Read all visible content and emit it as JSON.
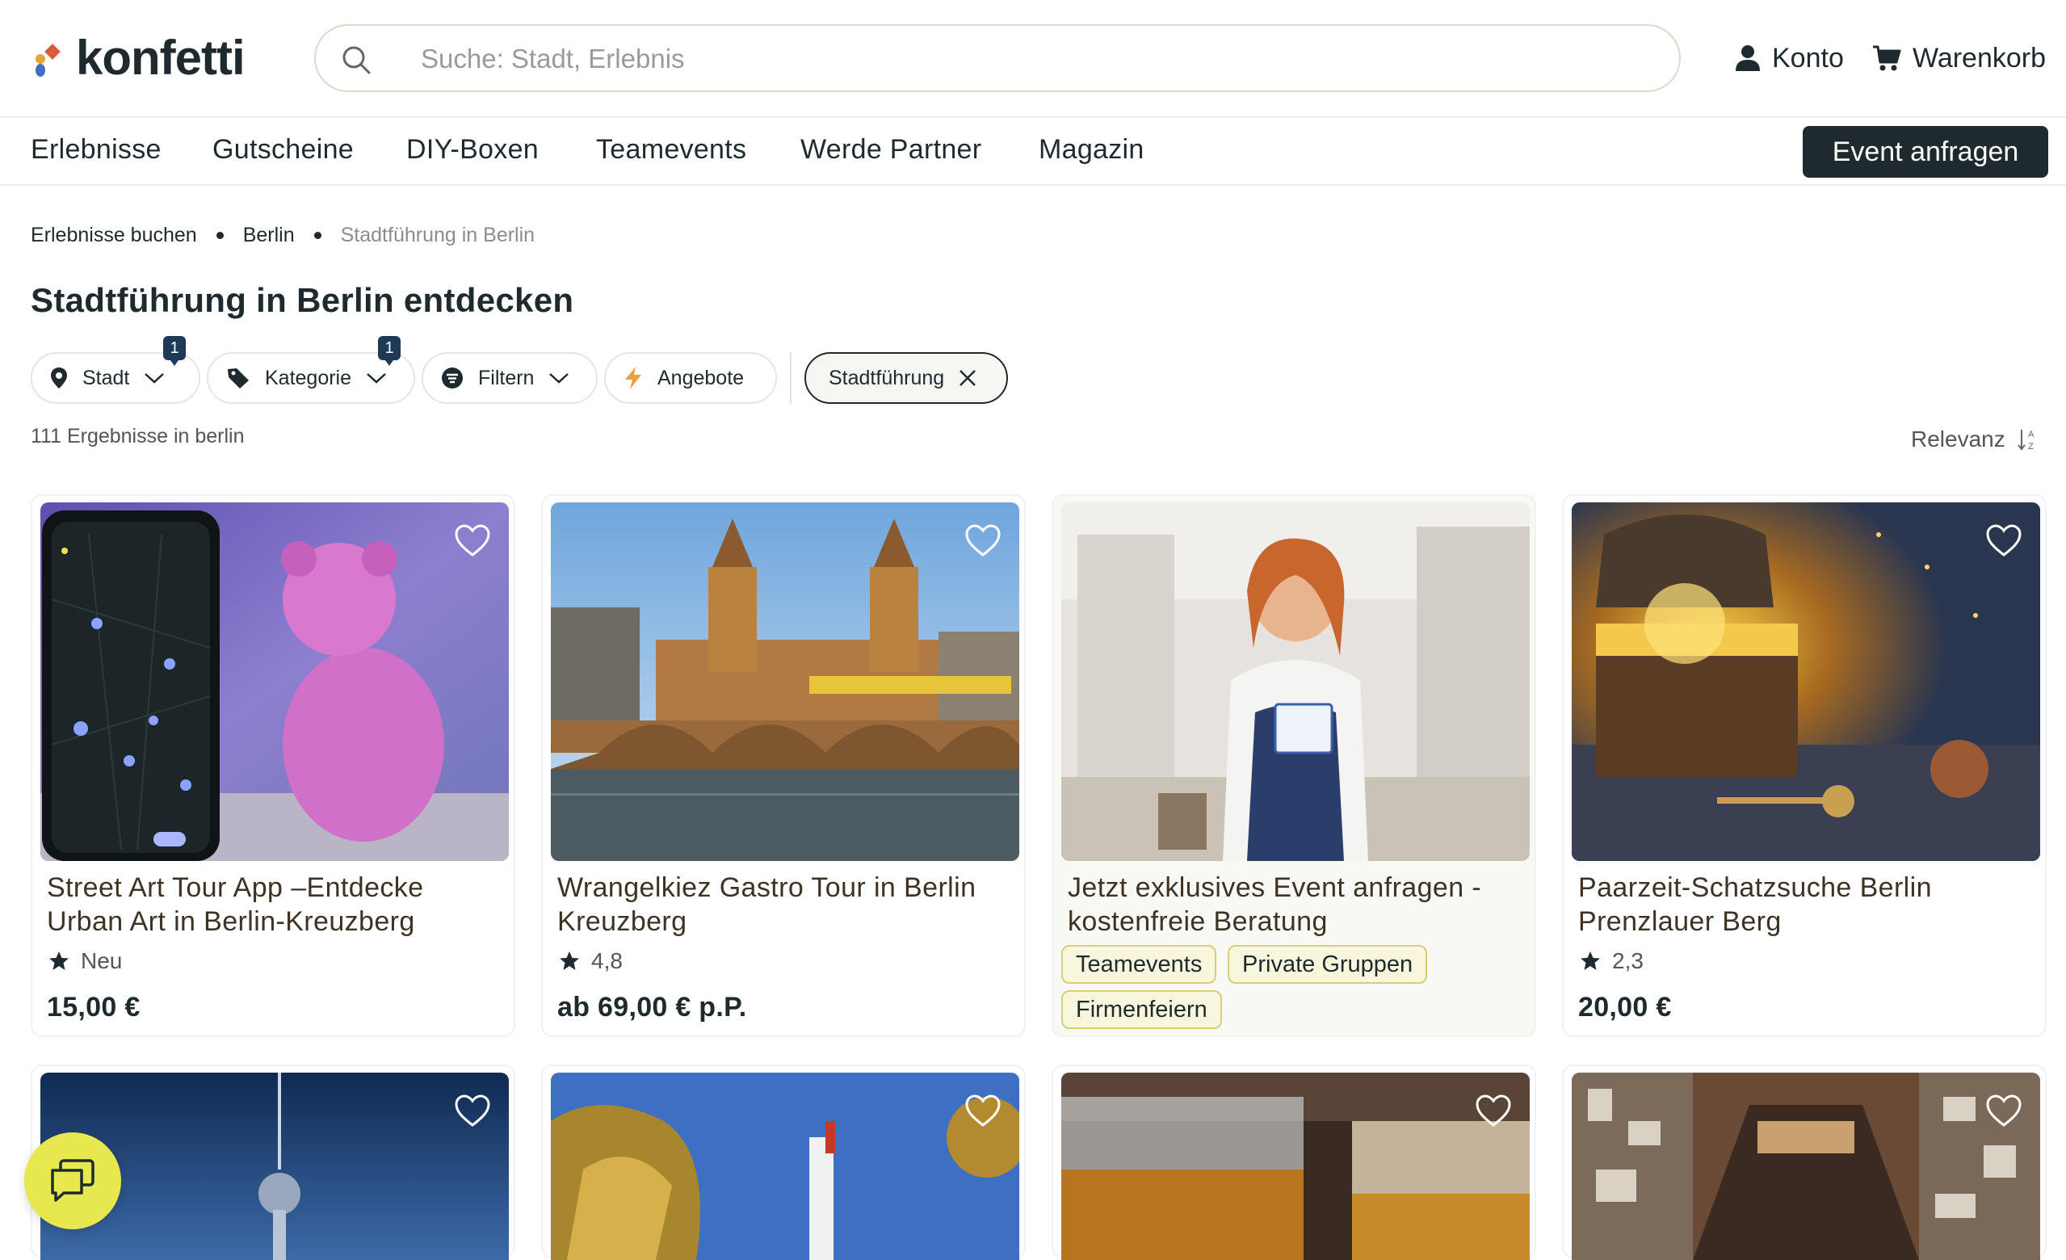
{
  "brand": {
    "name": "konfetti",
    "colors": {
      "dark": "#1f2a2e",
      "accent_yellow": "#e6e84e",
      "badge": "#1f3a56"
    }
  },
  "search": {
    "placeholder": "Suche: Stadt, Erlebnis",
    "value": ""
  },
  "header": {
    "account_label": "Konto",
    "cart_label": "Warenkorb"
  },
  "nav": {
    "items": [
      "Erlebnisse",
      "Gutscheine",
      "DIY-Boxen",
      "Teamevents",
      "Werde Partner",
      "Magazin"
    ],
    "cta_label": "Event anfragen"
  },
  "breadcrumb": [
    "Erlebnisse buchen",
    "Berlin",
    "Stadtführung in Berlin"
  ],
  "page_title": "Stadtführung in Berlin entdecken",
  "filters": {
    "city": {
      "label": "Stadt",
      "badge": "1"
    },
    "category": {
      "label": "Kategorie",
      "badge": "1"
    },
    "filter": {
      "label": "Filtern"
    },
    "offers": {
      "label": "Angebote"
    },
    "active_tag": {
      "label": "Stadtführung"
    }
  },
  "results_text": "111 Ergebnisse in berlin",
  "sort_label": "Relevanz",
  "cards": [
    {
      "title": "Street Art Tour App –Entdecke Urban Art in Berlin-Kreuzberg",
      "rating": "Neu",
      "price": "15,00 €"
    },
    {
      "title": "Wrangelkiez Gastro Tour in Berlin Kreuzberg",
      "rating": "4,8",
      "price": "ab 69,00 € p.P."
    },
    {
      "title": "Jetzt exklusives Event anfragen - kostenfreie Beratung",
      "tags": [
        "Teamevents",
        "Private Gruppen",
        "Firmenfeiern"
      ]
    },
    {
      "title": "Paarzeit-Schatzsuche Berlin Prenzlauer Berg",
      "rating": "2,3",
      "price": "20,00 €"
    }
  ],
  "icons": [
    "search-icon",
    "user-icon",
    "cart-icon",
    "location-pin-icon",
    "tag-icon",
    "filter-icon",
    "lightning-icon",
    "close-icon",
    "chevron-down-icon",
    "sort-icon",
    "heart-icon",
    "star-icon",
    "chat-icon"
  ]
}
